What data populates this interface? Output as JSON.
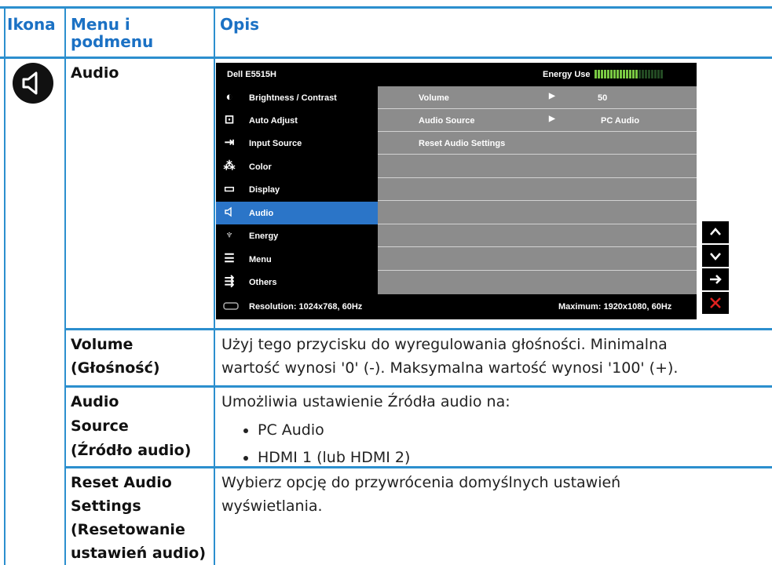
{
  "headers": {
    "icon": "Ikona",
    "menu": "Menu i podmenu",
    "desc": "Opis"
  },
  "audio_row": {
    "label": "Audio",
    "icon": "speaker-icon"
  },
  "osd": {
    "model": "Dell E5515H",
    "energy_label": "Energy Use",
    "energy_level": 0.62,
    "menu_items": [
      {
        "label": "Brightness / Contrast",
        "icon": "brightness-icon"
      },
      {
        "label": "Auto Adjust",
        "icon": "auto-adjust-icon"
      },
      {
        "label": "Input Source",
        "icon": "input-source-icon"
      },
      {
        "label": "Color",
        "icon": "color-icon"
      },
      {
        "label": "Display",
        "icon": "display-icon"
      },
      {
        "label": "Audio",
        "icon": "audio-icon",
        "selected": true
      },
      {
        "label": "Energy",
        "icon": "energy-icon"
      },
      {
        "label": "Menu",
        "icon": "menu-icon"
      },
      {
        "label": "Others",
        "icon": "others-icon"
      }
    ],
    "submenu": [
      {
        "name": "Volume",
        "value": "50"
      },
      {
        "name": "Audio Source",
        "value": "PC Audio"
      },
      {
        "name": "Reset Audio Settings",
        "value": ""
      }
    ],
    "resolution": "Resolution: 1024x768, 60Hz",
    "maximum": "Maximum: 1920x1080, 60Hz",
    "nav_buttons": [
      "up-icon",
      "down-icon",
      "right-arrow-icon",
      "close-icon"
    ],
    "close_color": "#e0211f",
    "selected_color": "#2b75c8"
  },
  "rows": [
    {
      "label1": "Volume",
      "label2": "(Głośność)",
      "desc1": "Użyj tego przycisku do wyregulowania głośności. Minimalna",
      "desc2": "wartość wynosi '0' (-). Maksymalna wartość wynosi '100' (+)."
    },
    {
      "label1": "Audio",
      "label2": "Source",
      "label3": "(Źródło audio)",
      "desc": "Umożliwia ustawienie Źródła audio na:",
      "bullets": [
        "PC Audio",
        "HDMI 1 (lub HDMI 2)"
      ]
    },
    {
      "label1": "Reset Audio",
      "label2": "Settings",
      "label3": "(Resetowanie",
      "label4": "ustawień audio)",
      "desc1": "Wybierz opcję do przywrócenia domyślnych ustawień",
      "desc2": "wyświetlania."
    }
  ]
}
